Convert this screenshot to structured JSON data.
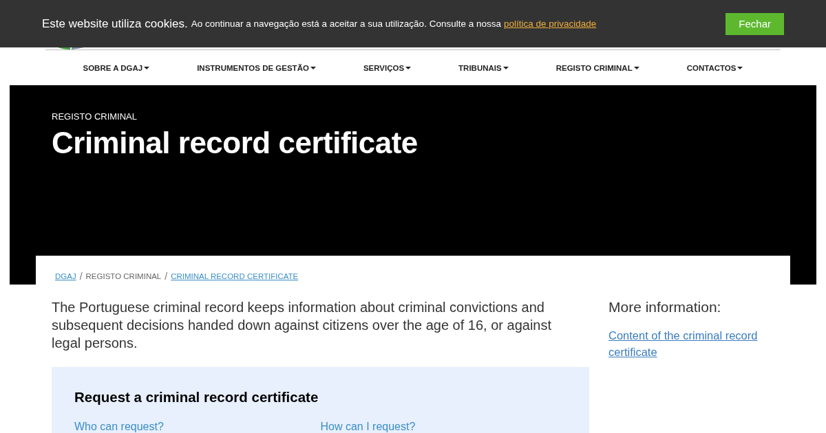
{
  "cookie_bar": {
    "title": "Este website utiliza cookies.",
    "text": "Ao continuar a navegação está a aceitar a sua utilização. Consulte a nossa",
    "link": "política de privacidade",
    "button": "Fechar"
  },
  "nav": [
    {
      "label": "SOBRE A DGAJ"
    },
    {
      "label": "INSTRUMENTOS DE GESTÃO"
    },
    {
      "label": "SERVIÇOS"
    },
    {
      "label": "TRIBUNAIS"
    },
    {
      "label": "REGISTO CRIMINAL"
    },
    {
      "label": "CONTACTOS"
    }
  ],
  "hero": {
    "eyebrow": "REGISTO CRIMINAL",
    "title": "Criminal record certificate"
  },
  "breadcrumb_separator": "/",
  "breadcrumb": [
    {
      "label": "DGAJ",
      "kind": "link"
    },
    {
      "label": "REGISTO CRIMINAL",
      "kind": "text"
    },
    {
      "label": "CRIMINAL RECORD CERTIFICATE",
      "kind": "link"
    }
  ],
  "intro": "The Portuguese criminal record keeps information about criminal convictions and subsequent decisions handed down against citizens over the age of 16, or against legal persons.",
  "request_box": {
    "title": "Request a criminal record certificate",
    "links": [
      "Who can request?",
      "How can I request?"
    ]
  },
  "sidebar": {
    "title": "More information:",
    "links": [
      "Content of the criminal record certificate"
    ]
  }
}
